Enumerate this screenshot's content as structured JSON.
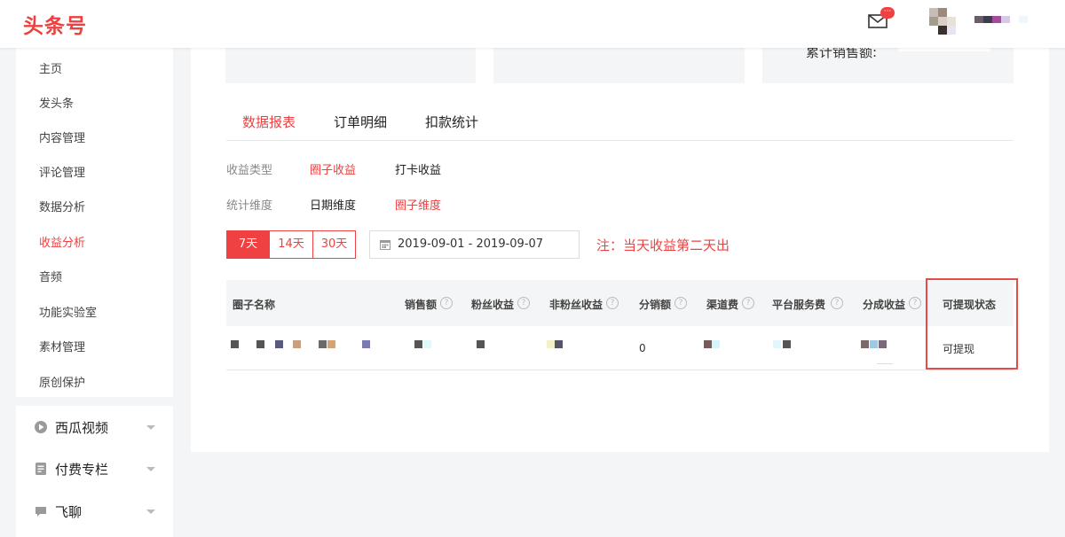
{
  "topbar": {
    "logo": "头条号",
    "mail_badge": "···"
  },
  "sidebar": {
    "items": [
      {
        "label": "主页",
        "active": false
      },
      {
        "label": "发头条",
        "active": false
      },
      {
        "label": "内容管理",
        "active": false
      },
      {
        "label": "评论管理",
        "active": false
      },
      {
        "label": "数据分析",
        "active": false
      },
      {
        "label": "收益分析",
        "active": true
      },
      {
        "label": "音频",
        "active": false
      },
      {
        "label": "功能实验室",
        "active": false
      },
      {
        "label": "素材管理",
        "active": false
      },
      {
        "label": "原创保护",
        "active": false
      }
    ],
    "groups": [
      {
        "label": "西瓜视频",
        "icon": "play-circle-icon"
      },
      {
        "label": "付费专栏",
        "icon": "document-icon"
      },
      {
        "label": "飞聊",
        "icon": "chat-icon"
      }
    ]
  },
  "stats": {
    "cumulative_label": "累计销售额:"
  },
  "tabs": [
    {
      "label": "数据报表",
      "active": true
    },
    {
      "label": "订单明细",
      "active": false
    },
    {
      "label": "扣款统计",
      "active": false
    }
  ],
  "filters": {
    "income_type": {
      "label": "收益类型",
      "options": [
        {
          "label": "圈子收益",
          "active": true
        },
        {
          "label": "打卡收益",
          "active": false
        }
      ]
    },
    "dimension": {
      "label": "统计维度",
      "options": [
        {
          "label": "日期维度",
          "active": false
        },
        {
          "label": "圈子维度",
          "active": true
        }
      ]
    }
  },
  "range_buttons": [
    {
      "label": "7天",
      "active": true
    },
    {
      "label": "14天",
      "active": false
    },
    {
      "label": "30天",
      "active": false
    }
  ],
  "date_range": "2019-09-01 - 2019-09-07",
  "note": "注：当天收益第二天出",
  "table": {
    "columns": [
      {
        "label": "圈子名称",
        "help": false
      },
      {
        "label": "销售额",
        "help": true
      },
      {
        "label": "粉丝收益",
        "help": true
      },
      {
        "label": "非粉丝收益",
        "help": true
      },
      {
        "label": "分销额",
        "help": true
      },
      {
        "label": "渠道费",
        "help": true
      },
      {
        "label": "平台服务费",
        "help": true
      },
      {
        "label": "分成收益",
        "help": true
      },
      {
        "label": "可提现状态",
        "help": false
      }
    ],
    "rows": [
      {
        "distribution": "0",
        "status": "可提现"
      }
    ]
  },
  "colors": {
    "accent": "#f04142",
    "highlight_box": "#e54b4b"
  }
}
